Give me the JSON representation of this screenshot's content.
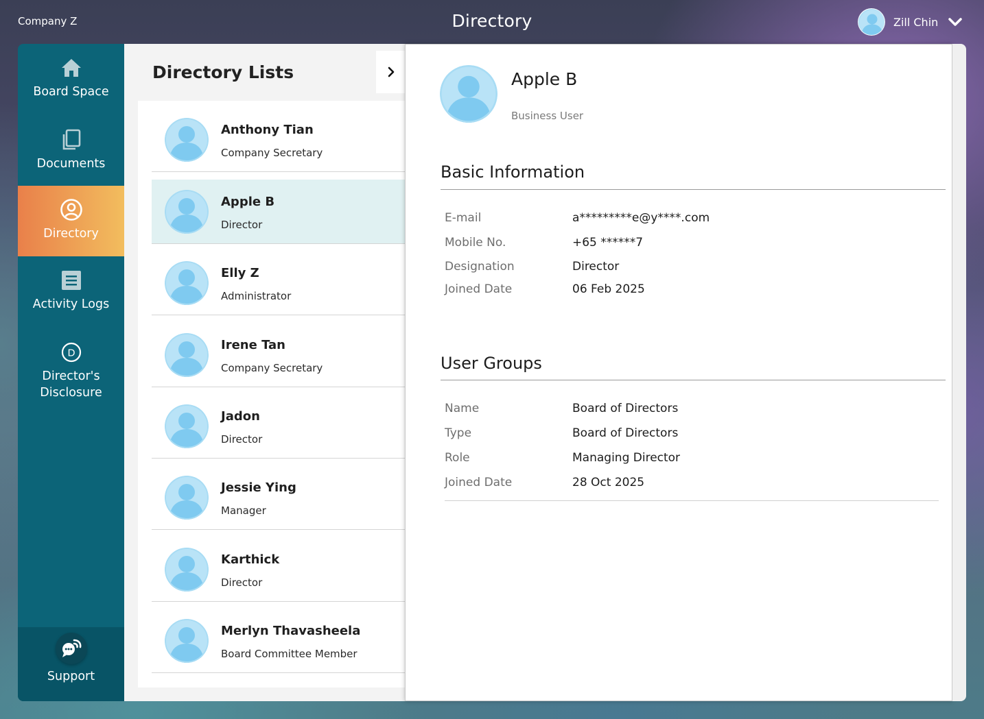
{
  "header": {
    "company": "Company Z",
    "title": "Directory",
    "user_name": "Zill Chin"
  },
  "sidebar": {
    "items": [
      {
        "label": "Board Space",
        "icon": "home-icon"
      },
      {
        "label": "Documents",
        "icon": "documents-icon"
      },
      {
        "label": "Directory",
        "icon": "user-circle-icon",
        "active": true
      },
      {
        "label": "Activity Logs",
        "icon": "list-icon"
      },
      {
        "label": "Director's Disclosure",
        "icon": "d-circle-icon"
      }
    ],
    "support_label": "Support"
  },
  "list": {
    "title": "Directory Lists",
    "people": [
      {
        "name": "Anthony Tian",
        "role": "Company Secretary"
      },
      {
        "name": "Apple B",
        "role": "Director",
        "selected": true
      },
      {
        "name": "Elly Z",
        "role": "Administrator"
      },
      {
        "name": "Irene Tan",
        "role": "Company Secretary"
      },
      {
        "name": "Jadon",
        "role": "Director"
      },
      {
        "name": "Jessie Ying",
        "role": "Manager"
      },
      {
        "name": "Karthick",
        "role": "Director"
      },
      {
        "name": "Merlyn Thavasheela",
        "role": "Board Committee Member"
      }
    ]
  },
  "detail": {
    "name": "Apple B",
    "user_type": "Business User",
    "basic_info": {
      "title": "Basic Information",
      "fields": [
        {
          "label": "E-mail",
          "value": "a*********e@y****.com"
        },
        {
          "label": "Mobile No.",
          "value": "+65 ******7"
        },
        {
          "label": "Designation",
          "value": "Director"
        },
        {
          "label": "Joined Date",
          "value": "06 Feb 2025"
        }
      ]
    },
    "user_groups": {
      "title": "User Groups",
      "fields": [
        {
          "label": "Name",
          "value": "Board of Directors"
        },
        {
          "label": "Type",
          "value": "Board of Directors"
        },
        {
          "label": "Role",
          "value": "Managing Director"
        },
        {
          "label": "Joined Date",
          "value": "28 Oct 2025"
        }
      ]
    }
  },
  "colors": {
    "sidebar": "#0c6478",
    "active_start": "#e9804a",
    "active_end": "#f2bd5e",
    "selected_row": "#e0f1f2",
    "avatar": "#8fd0f0"
  }
}
